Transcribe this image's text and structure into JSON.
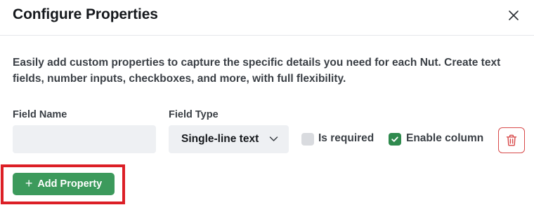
{
  "dialog": {
    "title": "Configure Properties",
    "description": "Easily add custom properties to capture the specific details you need for each Nut. Create text fields, number inputs, checkboxes, and more, with full flexibility."
  },
  "fields": {
    "name_label": "Field Name",
    "name_value": "",
    "type_label": "Field Type",
    "type_selected": "Single-line text",
    "required_label": "Is required",
    "required_checked": false,
    "enable_column_label": "Enable column",
    "enable_column_checked": true
  },
  "actions": {
    "add_label": "Add Property"
  },
  "icons": {
    "close": "close-icon",
    "chevron": "chevron-down-icon",
    "check": "check-icon",
    "delete": "trash-icon",
    "plus": "plus-icon"
  },
  "colors": {
    "primary_green": "#3c9a5c",
    "checkbox_green": "#2f8a4e",
    "danger_red": "#d84a4a",
    "highlight_red": "#dc1f26",
    "input_bg": "#eef0f3"
  }
}
